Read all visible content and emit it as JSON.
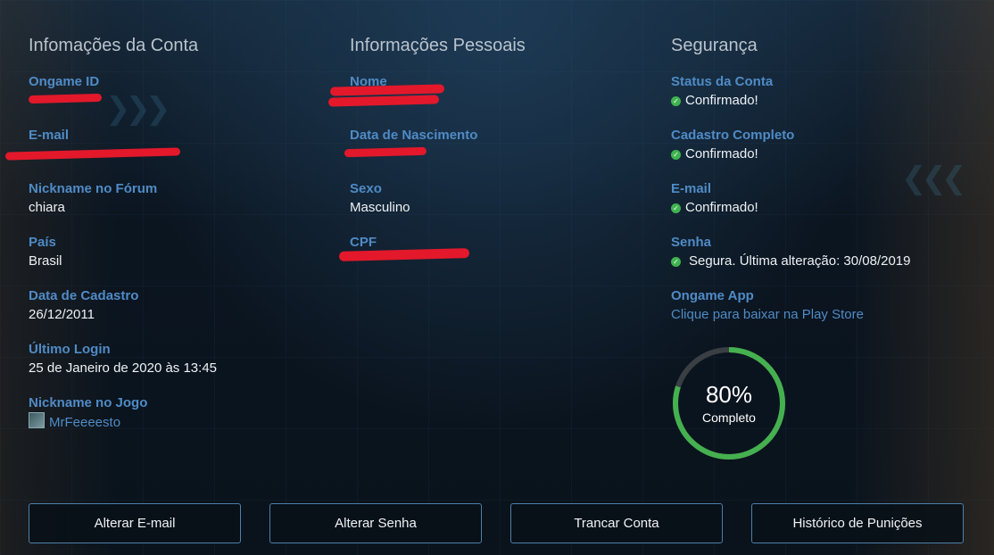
{
  "account": {
    "title": "Infomações da Conta",
    "fields": [
      {
        "label": "Ongame ID",
        "value": ""
      },
      {
        "label": "E-mail",
        "value": ""
      },
      {
        "label": "Nickname no Fórum",
        "value": "chiara"
      },
      {
        "label": "País",
        "value": "Brasil"
      },
      {
        "label": "Data de Cadastro",
        "value": "26/12/2011"
      },
      {
        "label": "Último Login",
        "value": "25 de Janeiro de 2020 às 13:45"
      },
      {
        "label": "Nickname no Jogo",
        "value": "MrFeeeesto"
      }
    ]
  },
  "personal": {
    "title": "Informações Pessoais",
    "fields": [
      {
        "label": "Nome",
        "value": ""
      },
      {
        "label": "Data de Nascimento",
        "value": ""
      },
      {
        "label": "Sexo",
        "value": "Masculino"
      },
      {
        "label": "CPF",
        "value": ""
      }
    ]
  },
  "security": {
    "title": "Segurança",
    "fields": [
      {
        "label": "Status da Conta",
        "value": "Confirmado!"
      },
      {
        "label": "Cadastro Completo",
        "value": "Confirmado!"
      },
      {
        "label": "E-mail",
        "value": "Confirmado!"
      },
      {
        "label": "Senha",
        "value": "Segura. Última alteração: 30/08/2019"
      },
      {
        "label": "Ongame App",
        "value": "Clique para baixar na Play Store"
      }
    ],
    "status_icon": "check-circle-icon",
    "status_color": "#3fb34f"
  },
  "progress": {
    "percent": 80,
    "percent_label": "80%",
    "caption": "Completo",
    "color": "#45b04f",
    "track_color": "#3a3f44"
  },
  "buttons": {
    "change_email": "Alterar E-mail",
    "change_password": "Alterar Senha",
    "lock_account": "Trancar Conta",
    "punishment_history": "Histórico de Punições"
  },
  "colors": {
    "accent": "#4f8bc6",
    "redaction": "#e3182b"
  }
}
